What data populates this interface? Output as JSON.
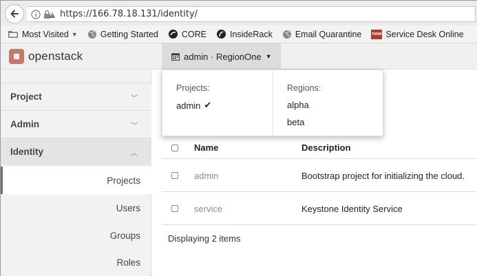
{
  "browser": {
    "url": "https://166.78.18.131/identity/",
    "bookmarks": [
      {
        "label": "Most Visited",
        "icon": "folder-icon",
        "has_caret": true
      },
      {
        "label": "Getting Started",
        "icon": "globe-icon"
      },
      {
        "label": "CORE",
        "icon": "core-icon"
      },
      {
        "label": "InsideRack",
        "icon": "insiderack-icon"
      },
      {
        "label": "Email Quarantine",
        "icon": "globe-icon"
      },
      {
        "label": "Service Desk Online",
        "icon": "now-icon",
        "icon_text": "now"
      }
    ]
  },
  "header": {
    "logo_text": "openstack",
    "context_label": "admin · RegionOne"
  },
  "dropdown": {
    "projects_heading": "Projects:",
    "projects": [
      {
        "label": "admin",
        "checked": true
      }
    ],
    "regions_heading": "Regions:",
    "regions": [
      {
        "label": "alpha"
      },
      {
        "label": "beta"
      }
    ]
  },
  "sidebar": {
    "sections": [
      {
        "label": "Project",
        "expanded": false
      },
      {
        "label": "Admin",
        "expanded": false
      },
      {
        "label": "Identity",
        "expanded": true
      }
    ],
    "items": [
      {
        "label": "Projects",
        "active": true
      },
      {
        "label": "Users"
      },
      {
        "label": "Groups"
      },
      {
        "label": "Roles"
      }
    ]
  },
  "table": {
    "headers": {
      "name": "Name",
      "description": "Description"
    },
    "rows": [
      {
        "name": "admin",
        "description": "Bootstrap project for initializing the cloud."
      },
      {
        "name": "service",
        "description": "Keystone Identity Service"
      }
    ],
    "footer": "Displaying 2 items"
  },
  "colors": {
    "accent": "#c47a6a",
    "link_gray": "#8a8a8a"
  }
}
